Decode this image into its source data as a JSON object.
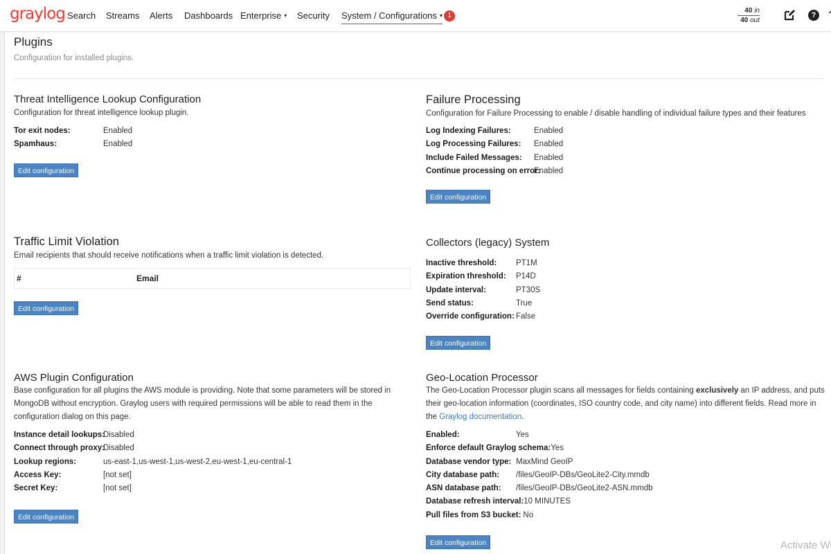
{
  "nav": {
    "brand": "graylog",
    "items": [
      {
        "label": "Search"
      },
      {
        "label": "Streams"
      },
      {
        "label": "Alerts"
      },
      {
        "label": "Dashboards"
      },
      {
        "label": "Enterprise",
        "caret": "▾"
      },
      {
        "label": "Security"
      },
      {
        "label": "System / Configurations",
        "caret": "▾"
      }
    ],
    "notification_count": "1",
    "throughput_in_value": "40",
    "throughput_in_unit": "in",
    "throughput_out_value": "40",
    "throughput_out_unit": "out",
    "help_label": "?"
  },
  "page": {
    "title": "Plugins",
    "subtitle": "Configuration for installed plugins."
  },
  "common": {
    "edit_label": "Edit configuration"
  },
  "threat_intel": {
    "title": "Threat Intelligence Lookup Configuration",
    "description": "Configuration for threat intelligence lookup plugin.",
    "rows": [
      {
        "key": "Tor exit nodes:",
        "value": "Enabled"
      },
      {
        "key": "Spamhaus:",
        "value": "Enabled"
      }
    ]
  },
  "failure_processing": {
    "title": "Failure Processing",
    "description": "Configuration for Failure Processing to enable / disable handling of individual failure types and their features",
    "rows": [
      {
        "key": "Log Indexing Failures:",
        "value": "Enabled"
      },
      {
        "key": "Log Processing Failures:",
        "value": "Enabled"
      },
      {
        "key": "Include Failed Messages:",
        "value": "Enabled"
      },
      {
        "key": "Continue processing on error:",
        "value": "Enabled"
      }
    ]
  },
  "traffic_limit": {
    "title": "Traffic Limit Violation",
    "description": "Email recipients that should receive notifications when a traffic limit violation is detected.",
    "table_headers": [
      "#",
      "Email"
    ]
  },
  "collectors": {
    "title": "Collectors (legacy) System",
    "rows": [
      {
        "key": "Inactive threshold:",
        "value": "PT1M"
      },
      {
        "key": "Expiration threshold:",
        "value": "P14D"
      },
      {
        "key": "Update interval:",
        "value": "PT30S"
      },
      {
        "key": "Send status:",
        "value": "True"
      },
      {
        "key": "Override configuration:",
        "value": "False"
      }
    ]
  },
  "aws": {
    "title": "AWS Plugin Configuration",
    "description": "Base configuration for all plugins the AWS module is providing. Note that some parameters will be stored in MongoDB without encryption. Graylog users with required permissions will be able to read them in the configuration dialog on this page.",
    "rows": [
      {
        "key": "Instance detail lookups:",
        "value": "Disabled"
      },
      {
        "key": "Connect through proxy:",
        "value": "Disabled"
      },
      {
        "key": "Lookup regions:",
        "value": "us-east-1,us-west-1,us-west-2,eu-west-1,eu-central-1"
      },
      {
        "key": "Access Key:",
        "value": "[not set]"
      },
      {
        "key": "Secret Key:",
        "value": "[not set]"
      }
    ]
  },
  "geo": {
    "title": "Geo-Location Processor",
    "desc_before": "The Geo-Location Processor plugin scans all messages for fields containing ",
    "desc_bold": "exclusively",
    "desc_after": " an IP address, and puts their geo-location information (coordinates, ISO country code, and city name) into different fields. Read more in the ",
    "desc_link": "Graylog documentation",
    "desc_end": ".",
    "rows": [
      {
        "key": "Enabled:",
        "value": "Yes"
      },
      {
        "key": "Enforce default Graylog schema:",
        "value": "Yes"
      },
      {
        "key": "Database vendor type:",
        "value": "MaxMind GeoIP"
      },
      {
        "key": "City database path:",
        "value": "/files/GeoIP-DBs/GeoLite2-City.mmdb"
      },
      {
        "key": "ASN database path:",
        "value": "/files/GeoIP-DBs/GeoLite2-ASN.mmdb"
      },
      {
        "key": "Database refresh interval:",
        "value": "10 MINUTES"
      },
      {
        "key": "Pull files from S3 bucket:",
        "value": "No"
      }
    ]
  },
  "watermark": "Activate Wi"
}
